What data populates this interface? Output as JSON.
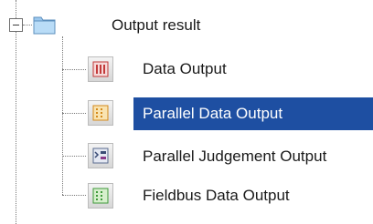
{
  "tree": {
    "root": {
      "label": "Output result",
      "expanded": true
    },
    "items": [
      {
        "label": "Data Output",
        "icon": "red-data-output-icon",
        "selected": false
      },
      {
        "label": "Parallel Data Output",
        "icon": "parallel-data-output-icon",
        "selected": true
      },
      {
        "label": "Parallel Judgement Output",
        "icon": "parallel-judgement-output-icon",
        "selected": false
      },
      {
        "label": "Fieldbus Data Output",
        "icon": "fieldbus-data-output-icon",
        "selected": false
      }
    ],
    "colors": {
      "selection": "#1e4fa2",
      "selection_text": "#ffffff",
      "folder": "#9cc8ee"
    }
  }
}
